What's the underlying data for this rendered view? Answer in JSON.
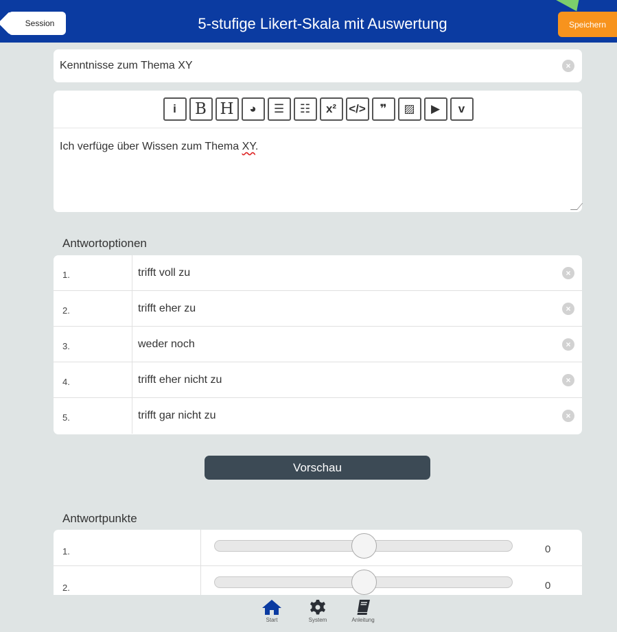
{
  "header": {
    "back_label": "Session",
    "title": "5-stufige Likert-Skala mit Auswertung",
    "save_label": "Speichern"
  },
  "question_title": {
    "value": "Kenntnisse zum Thema XY"
  },
  "editor": {
    "toolbar": [
      {
        "icon": "info-icon",
        "glyph": "i"
      },
      {
        "icon": "bold-icon",
        "glyph": "B"
      },
      {
        "icon": "heading-icon",
        "glyph": "H"
      },
      {
        "icon": "globe-link-icon",
        "glyph": "◕"
      },
      {
        "icon": "bullet-list-icon",
        "glyph": "☰"
      },
      {
        "icon": "numbered-list-icon",
        "glyph": "☷"
      },
      {
        "icon": "superscript-icon",
        "glyph": "x²"
      },
      {
        "icon": "code-icon",
        "glyph": "</>"
      },
      {
        "icon": "quote-icon",
        "glyph": "❞"
      },
      {
        "icon": "image-icon",
        "glyph": "▨"
      },
      {
        "icon": "youtube-icon",
        "glyph": "▶"
      },
      {
        "icon": "vimeo-icon",
        "glyph": "v"
      }
    ],
    "content_prefix": "Ich verfüge über Wissen zum Thema ",
    "content_flagged": "XY",
    "content_suffix": "."
  },
  "answer_options": {
    "label": "Antwortoptionen",
    "items": [
      {
        "num": "1.",
        "text": "trifft voll zu"
      },
      {
        "num": "2.",
        "text": "trifft eher zu"
      },
      {
        "num": "3.",
        "text": "weder noch"
      },
      {
        "num": "4.",
        "text": "trifft eher nicht zu"
      },
      {
        "num": "5.",
        "text": "trifft gar nicht zu"
      }
    ]
  },
  "preview_label": "Vorschau",
  "answer_points": {
    "label": "Antwortpunkte",
    "range": [
      -10,
      10
    ],
    "items": [
      {
        "num": "1.",
        "value": 0
      },
      {
        "num": "2.",
        "value": 0
      }
    ]
  },
  "bottom_nav": [
    {
      "label": "Start",
      "icon": "home-icon"
    },
    {
      "label": "System",
      "icon": "gear-icon"
    },
    {
      "label": "Anleitung",
      "icon": "book-icon"
    }
  ],
  "colors": {
    "header_bg": "#0b3ba1",
    "save_button": "#f7931d",
    "preview_button": "#3c4a55",
    "nav_icon": "#0b3ba1",
    "tutorial_arrow": "#7ccf6c"
  }
}
